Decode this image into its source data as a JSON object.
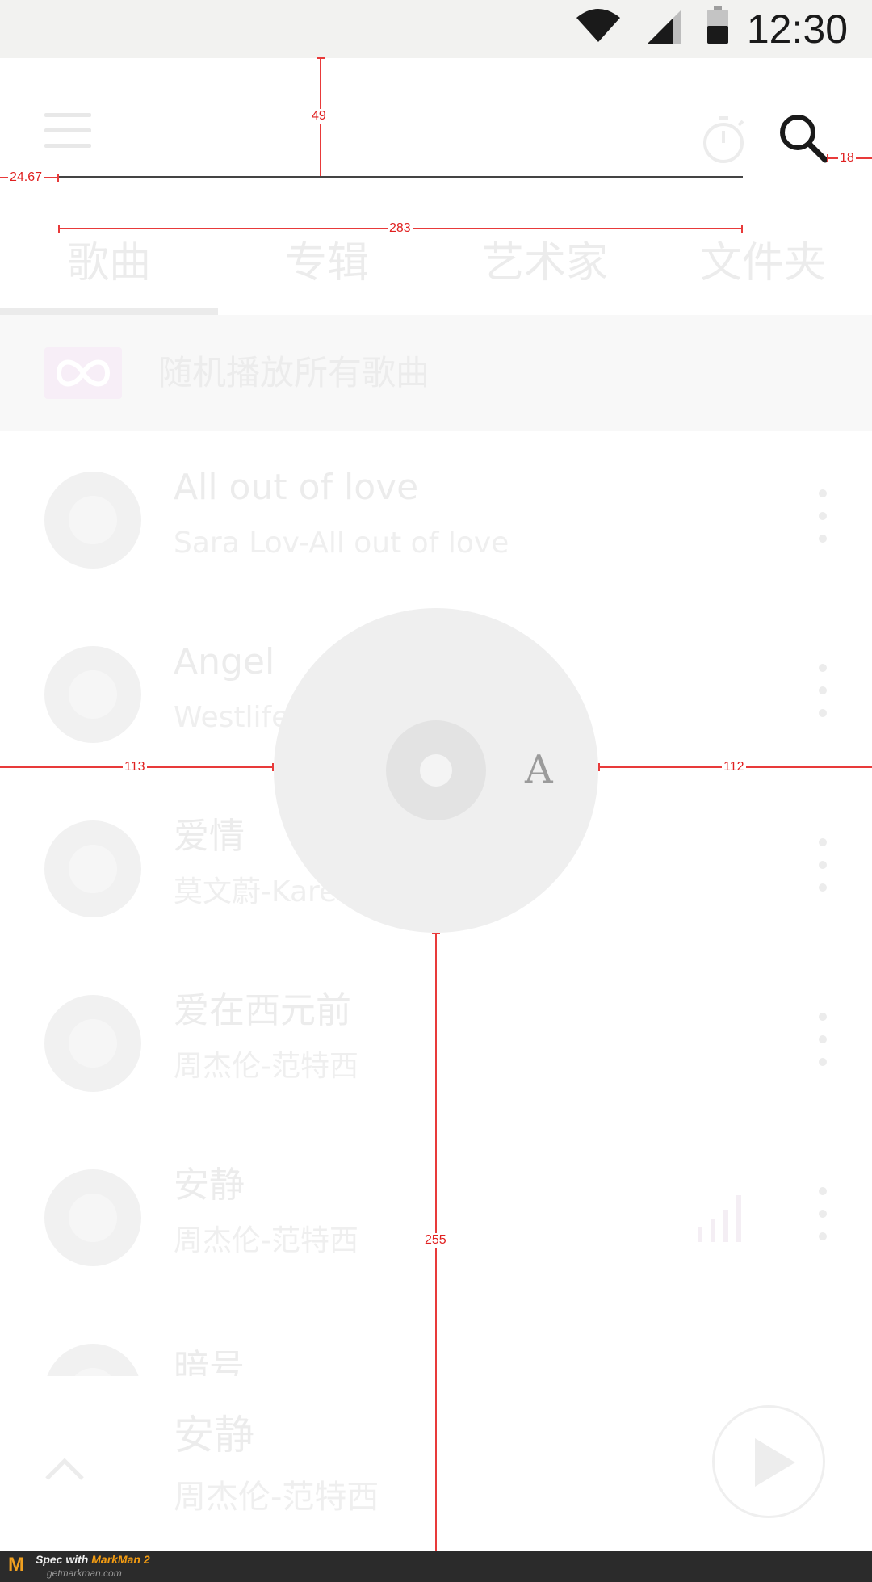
{
  "status_bar": {
    "time": "12:30",
    "icons": [
      "wifi-icon",
      "signal-icon",
      "battery-icon"
    ]
  },
  "toolbar": {
    "icons": [
      "menu-icon",
      "timer-icon",
      "search-icon"
    ]
  },
  "tabs": [
    {
      "label": "歌曲",
      "selected": true
    },
    {
      "label": "专辑",
      "selected": false
    },
    {
      "label": "艺术家",
      "selected": false
    },
    {
      "label": "文件夹",
      "selected": false
    }
  ],
  "shuffle": {
    "label": "随机播放所有歌曲",
    "icon": "infinity-icon"
  },
  "songs": [
    {
      "title": "All out of love",
      "subtitle": "Sara Lov-All out of love"
    },
    {
      "title": "Angel",
      "subtitle": "Westlife"
    },
    {
      "title": "爱情",
      "subtitle": "莫文蔚-Karen精选全纪录"
    },
    {
      "title": "爱在西元前",
      "subtitle": "周杰伦-范特西"
    },
    {
      "title": "安静",
      "subtitle": "周杰伦-范特西"
    },
    {
      "title": "暗号",
      "subtitle": ""
    }
  ],
  "now_playing": {
    "title": "安静",
    "subtitle": "周杰伦-范特西"
  },
  "overlay": {
    "letter": "A"
  },
  "measurements": {
    "top": "49",
    "left": "24.67",
    "right": "18",
    "width": "283",
    "disc_left": "113",
    "disc_right": "112",
    "disc_bottom": "255"
  },
  "footer": {
    "spec": "Spec with",
    "brand": "MarkMan 2",
    "site": "getmarkman.com"
  },
  "colors": {
    "measure": "#e83a3a",
    "footer_bg": "#2b2b2b",
    "accent": "#f39c12"
  }
}
